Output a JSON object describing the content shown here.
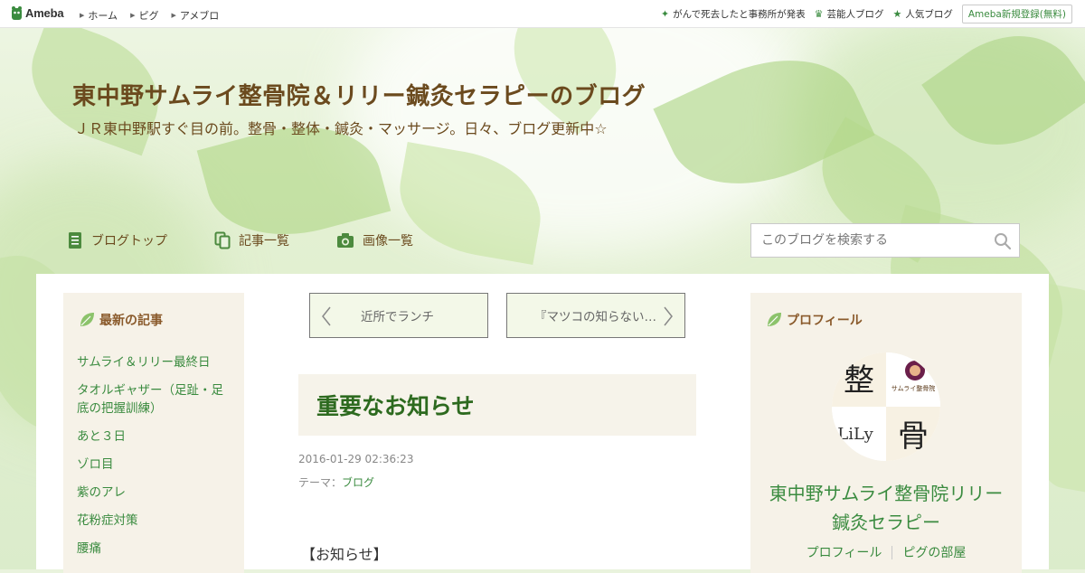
{
  "topbar": {
    "logo_text": "Ameba",
    "nav": [
      "ホーム",
      "ピグ",
      "アメブロ"
    ],
    "right_links": [
      {
        "icon": "sparkle-icon",
        "label": "がんで死去したと事務所が発表"
      },
      {
        "icon": "crown-icon",
        "label": "芸能人ブログ"
      },
      {
        "icon": "star-icon",
        "label": "人気ブログ"
      }
    ],
    "register_label": "Ameba新規登録(無料)"
  },
  "header": {
    "title": "東中野サムライ整骨院＆リリー鍼灸セラピーのブログ",
    "description": "ＪＲ東中野駅すぐ目の前。整骨・整体・鍼灸・マッサージ。日々、ブログ更新中☆",
    "nav": [
      {
        "icon": "document-icon",
        "label": "ブログトップ"
      },
      {
        "icon": "copy-icon",
        "label": "記事一覧"
      },
      {
        "icon": "camera-icon",
        "label": "画像一覧"
      }
    ],
    "search_placeholder": "このブログを検索する"
  },
  "sidebar_left": {
    "heading": "最新の記事",
    "items": [
      "サムライ＆リリー最終日",
      "タオルギャザー（足趾・足底の把握訓練）",
      "あと３日",
      "ゾロ目",
      "紫のアレ",
      "花粉症対策",
      "腰痛"
    ]
  },
  "article": {
    "prev_label": "近所でランチ",
    "next_label": "『マツコの知らない世界』",
    "title": "重要なお知らせ",
    "date": "2016-01-29 02:36:23",
    "theme_prefix": "テーマ：",
    "theme": "ブログ",
    "body_first_line": "【お知らせ】"
  },
  "profile": {
    "heading": "プロフィール",
    "name_line1": "東中野サムライ整骨院リリー",
    "name_line2": "鍼灸セラピー",
    "links": [
      "プロフィール",
      "ピグの部屋"
    ],
    "avatar_text": {
      "tl": "整",
      "tr": "サムライ整骨院",
      "bl": "LiLy",
      "br": "骨"
    }
  },
  "colors": {
    "accent_green": "#3a8b3f",
    "title_brown": "#6b4a1e",
    "sidebar_bg": "#f6f2e8"
  }
}
